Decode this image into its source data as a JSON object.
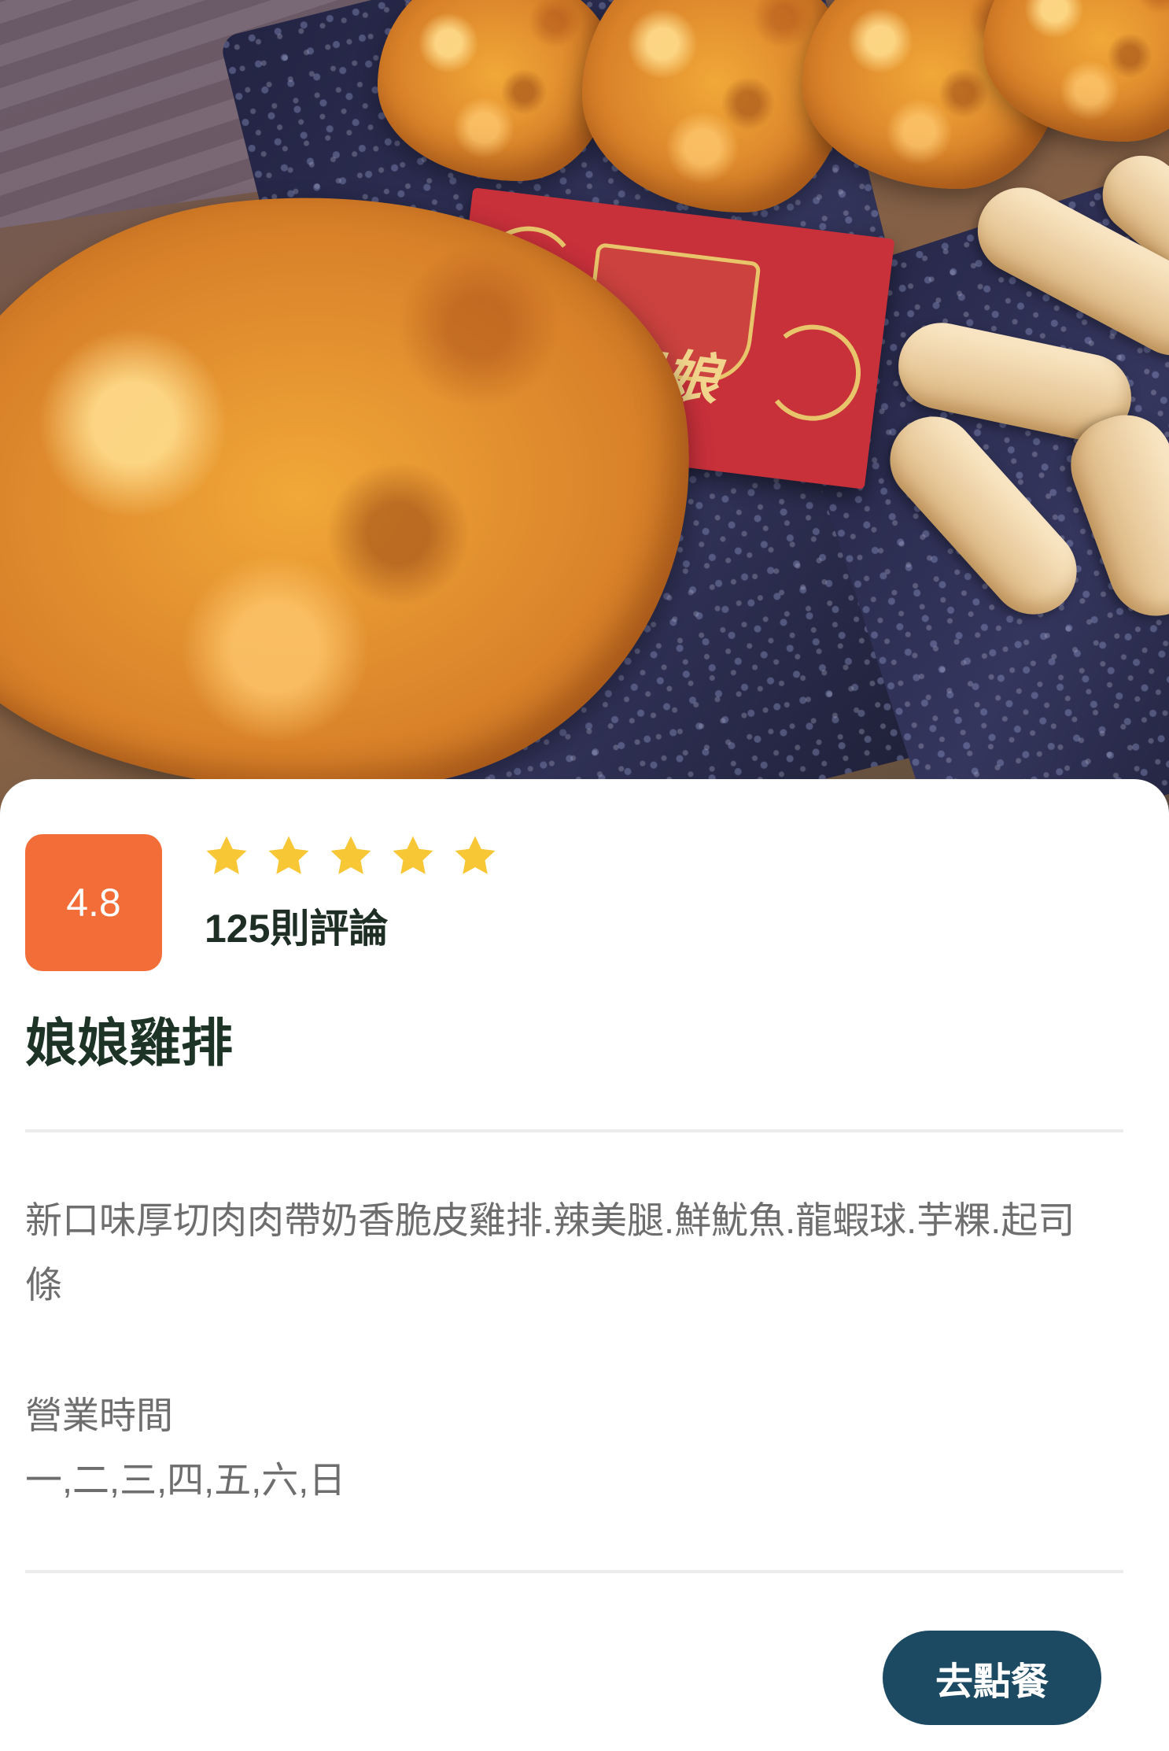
{
  "hero": {
    "image": "fried-chicken-cutlet-photo",
    "card_logo_text": "娘娘"
  },
  "store": {
    "rating": "4.8",
    "stars_filled": 5,
    "stars_total": 5,
    "star_color": "#f7c736",
    "review_count": "125則評論",
    "name": "娘娘雞排",
    "description": "新口味厚切肉肉帶奶香脆皮雞排.辣美腿.鮮魷魚.龍蝦球.芋粿.起司條",
    "hours_label": "營業時間",
    "hours_days": "一,二,三,四,五,六,日"
  },
  "actions": {
    "order_label": "去點餐"
  },
  "colors": {
    "rating_badge": "#f26d38",
    "button_bg": "#1d4a63",
    "title_text": "#1c3326",
    "body_text": "#6e6e6e"
  }
}
